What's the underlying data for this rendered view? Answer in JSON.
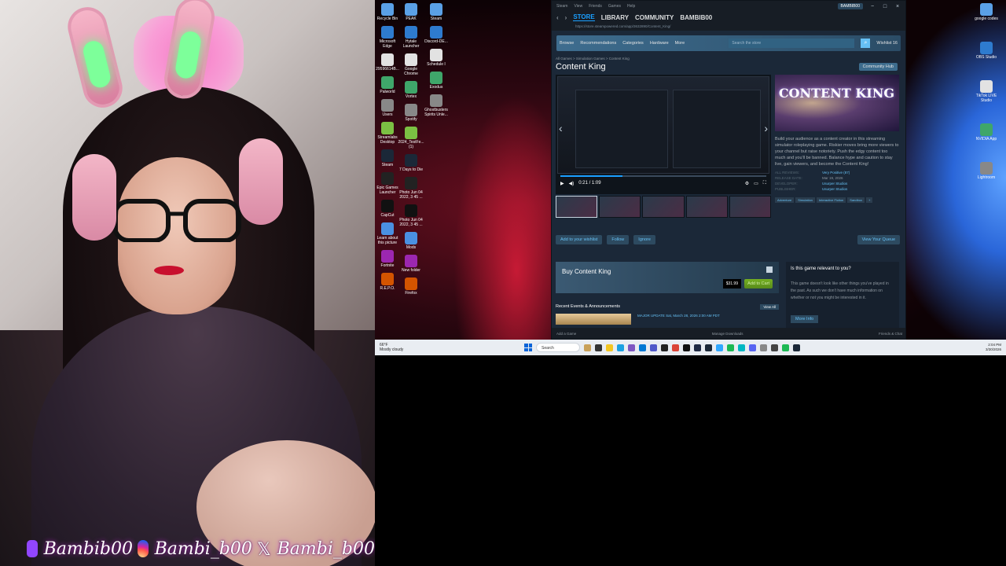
{
  "webcam": {
    "social": {
      "twitch": "Bambib00",
      "instagram": "Bambi_b00",
      "x": "Bambi_b00"
    }
  },
  "desktop": {
    "icons_col1": [
      "Recycle Bin",
      "Microsoft Edge",
      "29596614B...",
      "Palworld",
      "Users",
      "Streamlabs Desktop",
      "Steam",
      "Epic Games Launcher",
      "CapCut",
      "Learn about this picture",
      "Fortnite",
      "R.E.P.O."
    ],
    "icons_col2": [
      "PEAK",
      "Hytale Launcher",
      "Google Chrome",
      "Vortex",
      "Spotify",
      "2024_TestFe... (1)",
      "7 Days to Die",
      "Photo Jun 04 2022, 3 45 ...",
      "Photo Jun 04 2022, 3 45 ...",
      "Mods",
      "New folder",
      "Firefox"
    ],
    "icons_col3": [
      "Steam",
      "Discord-DE...",
      "Schedule I",
      "Exodus",
      "Ghostbusters Spirits Unle..."
    ],
    "icons_right": [
      "google codes",
      "OBS Studio",
      "TikTok LIVE Studio",
      "NVIDIA App",
      "Lightroom"
    ]
  },
  "steam": {
    "titlebar": {
      "menus": [
        "Steam",
        "View",
        "Friends",
        "Games",
        "Help"
      ],
      "account": "BAMBIB00"
    },
    "nav": {
      "store": "STORE",
      "library": "LIBRARY",
      "community": "COMMUNITY",
      "user": "BAMBIB00"
    },
    "url": "https://store.steampowered.com/app/3632890/Content_King/",
    "menubar": {
      "items": [
        "Browse",
        "Recommendations",
        "Categories",
        "Hardware",
        "More"
      ],
      "search_placeholder": "Search the store",
      "wishlist": "Wishlist 16"
    },
    "breadcrumb": "All Games > Simulation Games > Content King",
    "game_title": "Content King",
    "community_hub": "Community Hub",
    "media": {
      "time": "0:21 / 1:09"
    },
    "capsule_logo": "CONTENT KING",
    "description": "Build your audience as a content creator in this streaming simulator roleplaying game. Riskier moves bring more viewers to your channel but raise notoriety. Push the edgy content too much and you'll be banned. Balance hype and caution to stay live, gain viewers, and become the Content King!",
    "meta": {
      "reviews_label": "ALL REVIEWS:",
      "reviews_value": "Very Positive (87)",
      "release_label": "RELEASE DATE:",
      "release_value": "Mar 19, 2026",
      "developer_label": "DEVELOPER:",
      "developer_value": "Usurper Studios",
      "publisher_label": "PUBLISHER:",
      "publisher_value": "Usurper Studios"
    },
    "tags": [
      "Adventure",
      "Simulation",
      "Interactive Fiction",
      "Sandbox",
      "+"
    ],
    "actions": {
      "wishlist": "Add to your wishlist",
      "follow": "Follow",
      "ignore": "Ignore",
      "queue": "View Your Queue"
    },
    "buy": {
      "title": "Buy Content King",
      "price": "$31.99",
      "cart": "Add to Cart"
    },
    "relevant": {
      "heading": "Is this game relevant to you?",
      "body": "This game doesn't look like other things you've played in the past. As such we don't have much information on whether or not you might be interested in it.",
      "more": "More Info"
    },
    "events": {
      "heading": "Recent Events & Announcements",
      "view_all": "View All",
      "item": "MAJOR UPDATE  Sat, March 28, 2026 2:00 AM PDT"
    },
    "bottombar": {
      "add_game": "Add a Game",
      "downloads": "Manage Downloads",
      "friends": "Friends & Chat"
    }
  },
  "taskbar": {
    "weather_temp": "66°F",
    "weather_desc": "Mostly cloudy",
    "search": "Search",
    "time": "2:04 PM",
    "date": "3/30/2026"
  }
}
